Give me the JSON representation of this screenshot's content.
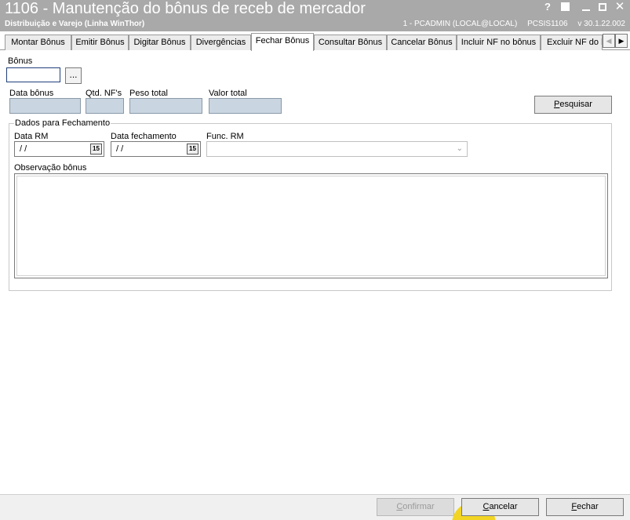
{
  "window": {
    "title": "1106 - Manutenção do bônus de receb de mercador",
    "subtitle": "Distribuição e Varejo (Linha WinThor)",
    "session": "1 - PCADMIN (LOCAL@LOCAL)",
    "routine": "PCSIS1106",
    "version": "v 30.1.22.002",
    "controls": {
      "help": "?",
      "close": "✕"
    }
  },
  "tabs": [
    {
      "label": "Montar Bônus"
    },
    {
      "label": "Emitir Bônus"
    },
    {
      "label": "Digitar Bônus"
    },
    {
      "label": "Divergências"
    },
    {
      "label": "Fechar Bônus",
      "active": true
    },
    {
      "label": "Consultar Bônus"
    },
    {
      "label": "Cancelar Bônus"
    },
    {
      "label": "Incluir NF no bônus"
    },
    {
      "label": "Excluir NF do b"
    }
  ],
  "tab_scroll": {
    "left": "◀",
    "right": "▶"
  },
  "form": {
    "bonus_label": "Bônus",
    "bonus_value": "",
    "ellipsis": "...",
    "data_bonus_label": "Data bônus",
    "qtd_nfs_label": "Qtd. NF's",
    "peso_total_label": "Peso total",
    "valor_total_label": "Valor total",
    "pesquisar": "Pesquisar",
    "pesquisar_hotkey": "P",
    "pesquisar_rest": "esquisar"
  },
  "fechamento": {
    "legend": "Dados para Fechamento",
    "data_rm_label": "Data RM",
    "data_rm_value": "/ /",
    "data_fechamento_label": "Data fechamento",
    "data_fechamento_value": "/ /",
    "calendar_glyph": "15",
    "func_rm_label": "Func. RM",
    "func_rm_value": "",
    "observacao_label": "Observação bônus",
    "observacao_value": ""
  },
  "footer": {
    "confirmar_hotkey": "C",
    "confirmar_rest": "onfirmar",
    "cancelar_hotkey": "C",
    "cancelar_rest": "ancelar",
    "fechar_hotkey": "F",
    "fechar_rest": "echar"
  }
}
